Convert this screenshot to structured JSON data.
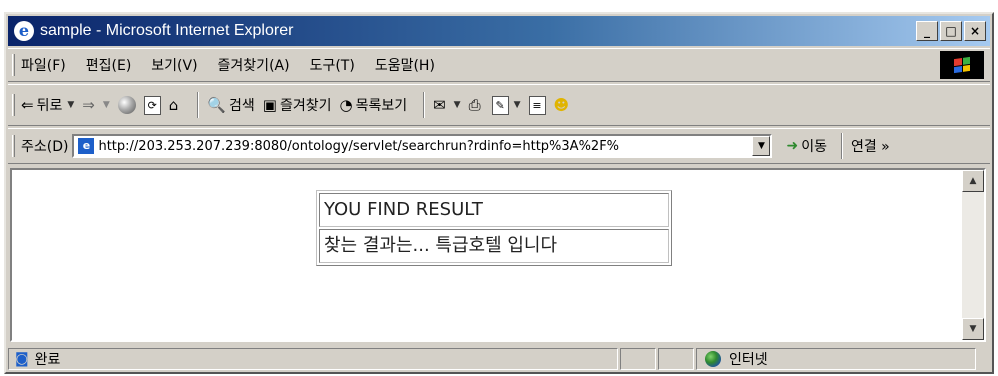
{
  "window": {
    "title": "sample - Microsoft Internet Explorer",
    "controls": {
      "minimize": "_",
      "maximize": "□",
      "close": "×"
    }
  },
  "menu": {
    "items": [
      "파일(F)",
      "편집(E)",
      "보기(V)",
      "즐겨찾기(A)",
      "도구(T)",
      "도움말(H)"
    ]
  },
  "toolbar": {
    "back_label": "뒤로",
    "search_label": "검색",
    "favorites_label": "즐겨찾기",
    "history_label": "목록보기"
  },
  "address": {
    "label": "주소(D)",
    "url": "http://203.253.207.239:8080/ontology/servlet/searchrun?rdinfo=http%3A%2F%",
    "go_label": "이동",
    "links_label": "연결 »"
  },
  "content": {
    "result_header": "YOU FIND RESULT",
    "result_value": "찾는 결과는... 특급호텔 입니다"
  },
  "status": {
    "text": "완료",
    "zone": "인터넷"
  },
  "colors": {
    "titlebar_start": "#0a246a",
    "titlebar_end": "#a6caf0",
    "chrome": "#d4d0c8"
  }
}
